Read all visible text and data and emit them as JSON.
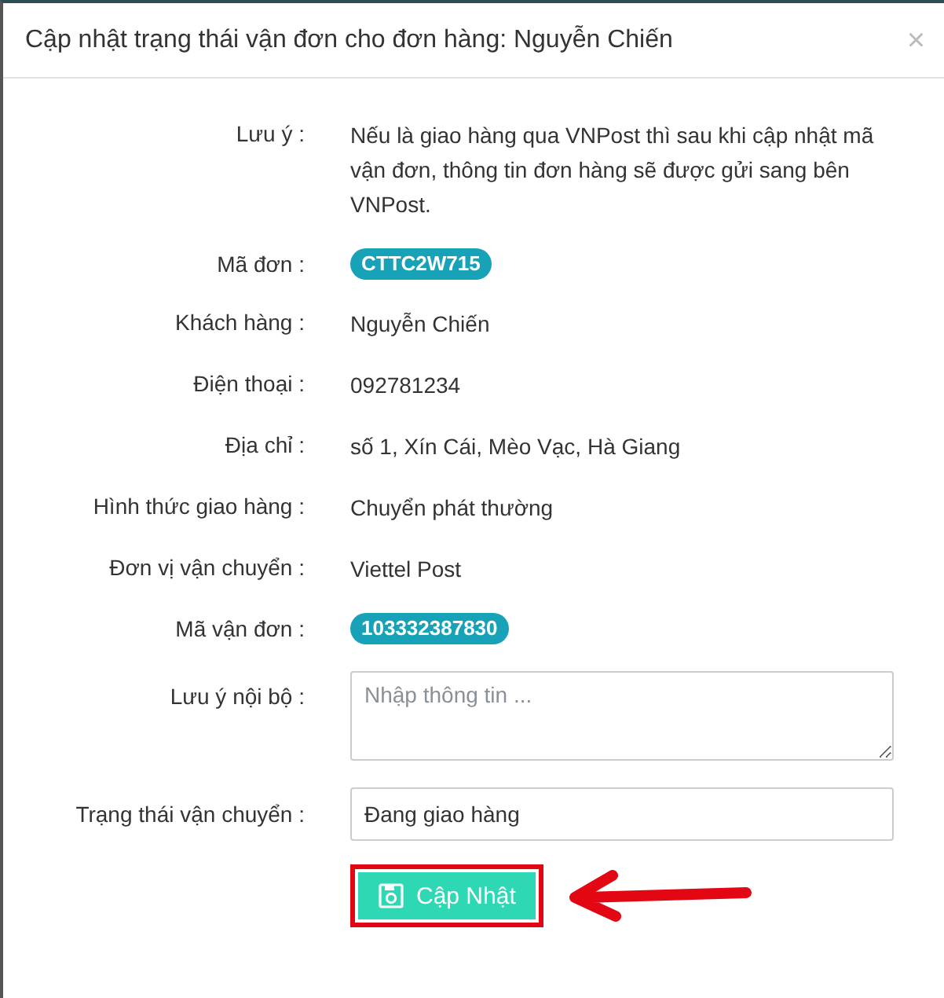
{
  "dialog": {
    "title": "Cập nhật trạng thái vận đơn cho đơn hàng: Nguyễn Chiến",
    "close": "×"
  },
  "fields": [
    {
      "kind": "text",
      "label": "Lưu ý :",
      "value": "Nếu là giao hàng qua VNPost thì sau khi cập nhật mã vận đơn, thông tin đơn hàng sẽ được gửi sang bên VNPost."
    },
    {
      "kind": "badge",
      "label": "Mã đơn :",
      "value": "CTTC2W715"
    },
    {
      "kind": "text",
      "label": "Khách hàng :",
      "value": "Nguyễn Chiến"
    },
    {
      "kind": "text",
      "label": "Điện thoại :",
      "value": "092781234"
    },
    {
      "kind": "text",
      "label": "Địa chỉ :",
      "value": "số 1, Xín Cái, Mèo Vạc, Hà Giang"
    },
    {
      "kind": "text",
      "label": "Hình thức giao hàng :",
      "value": "Chuyển phát thường"
    },
    {
      "kind": "text",
      "label": "Đơn vị vận chuyển :",
      "value": "Viettel Post"
    },
    {
      "kind": "badge",
      "label": "Mã vận đơn :",
      "value": "103332387830"
    },
    {
      "kind": "textarea",
      "label": "Lưu ý nội bộ :",
      "placeholder": "Nhập thông tin ..."
    },
    {
      "kind": "input",
      "label": "Trạng thái vận chuyển :",
      "value": "Đang giao hàng"
    }
  ],
  "submit_button": {
    "label": "Cập Nhật",
    "highlighted": true
  }
}
